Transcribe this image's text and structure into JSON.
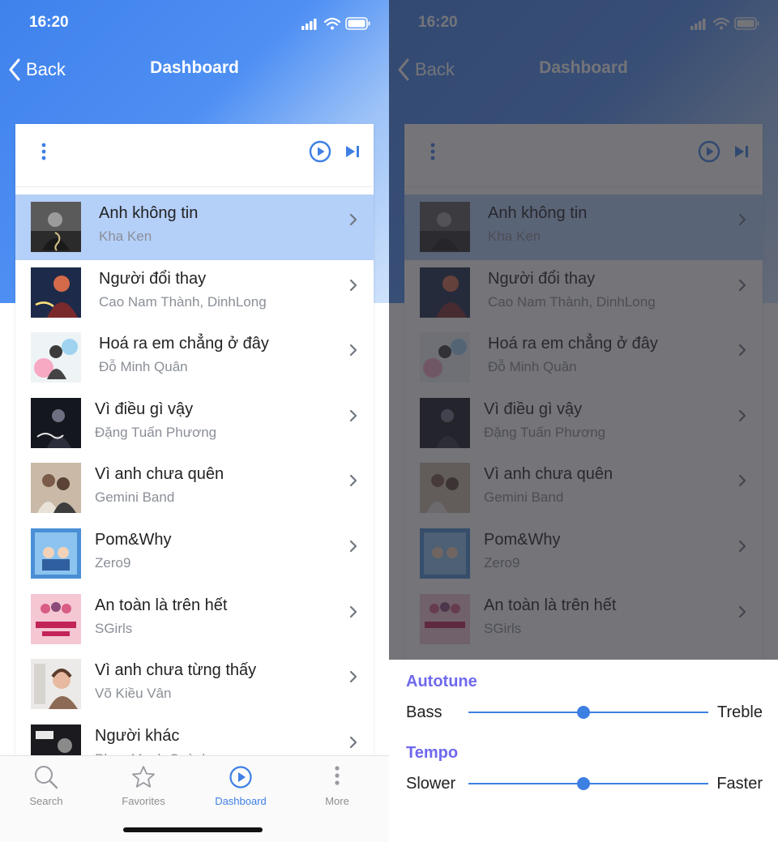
{
  "status_bar": {
    "time": "16:20"
  },
  "nav": {
    "back_label": "Back",
    "title": "Dashboard"
  },
  "songs": [
    {
      "title": "Anh không tin",
      "artist": "Kha Ken"
    },
    {
      "title": "Người đổi thay",
      "artist": "Cao Nam Thành, DinhLong"
    },
    {
      "title": "Hoá ra em chẳng ở đây",
      "artist": "Đỗ Minh Quân"
    },
    {
      "title": "Vì điều gì vậy",
      "artist": "Đặng Tuấn Phương"
    },
    {
      "title": "Vì anh chưa quên",
      "artist": "Gemini Band"
    },
    {
      "title": "Pom&Why",
      "artist": "Zero9"
    },
    {
      "title": "An toàn là trên hết",
      "artist": "SGirls"
    },
    {
      "title": "Vì anh chưa từng thấy",
      "artist": "Võ Kiều Vân"
    },
    {
      "title": "Người khác",
      "artist": "Phan Mạnh Quỳnh"
    }
  ],
  "tabs": [
    {
      "label": "Search",
      "icon": "search-icon"
    },
    {
      "label": "Favorites",
      "icon": "star-icon"
    },
    {
      "label": "Dashboard",
      "icon": "play-circle-icon"
    },
    {
      "label": "More",
      "icon": "more-vertical-icon"
    }
  ],
  "settings_sheet": {
    "autotune": {
      "heading": "Autotune",
      "min_label": "Bass",
      "max_label": "Treble",
      "value": 0.48
    },
    "tempo": {
      "heading": "Tempo",
      "min_label": "Slower",
      "max_label": "Faster",
      "value": 0.48
    }
  },
  "colors": {
    "accent": "#3d7fe3",
    "selected_row": "#b4cff8",
    "sheet_heading": "#6f69ec",
    "secondary_text": "#8a8f97"
  }
}
